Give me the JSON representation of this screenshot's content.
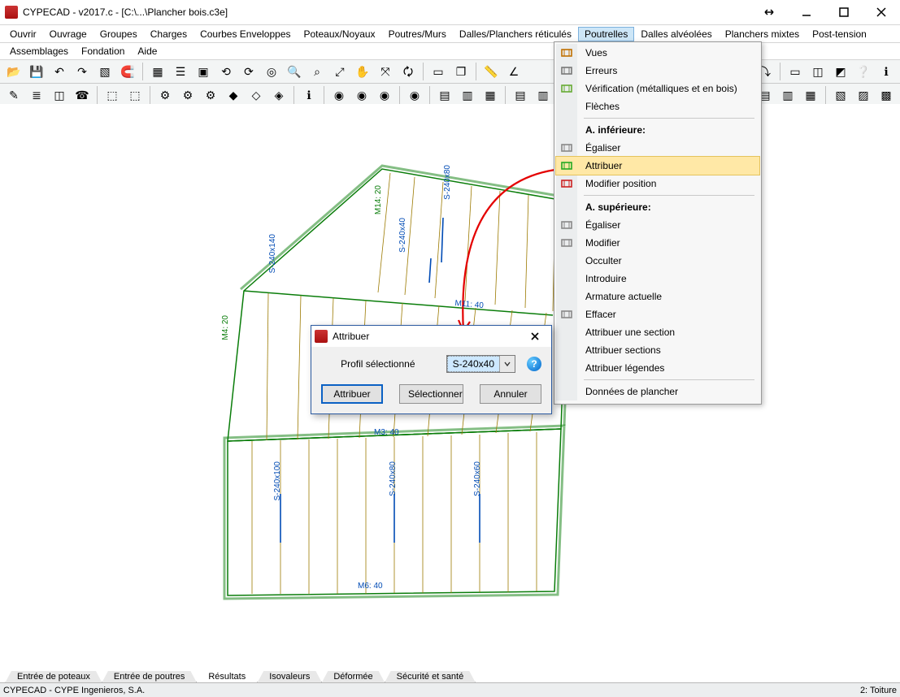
{
  "window": {
    "title": "CYPECAD - v2017.c - [C:\\...\\Plancher bois.c3e]"
  },
  "menubar": {
    "row1": [
      "Ouvrir",
      "Ouvrage",
      "Groupes",
      "Charges",
      "Courbes Enveloppes",
      "Poteaux/Noyaux",
      "Poutres/Murs",
      "Dalles/Planchers réticulés",
      "Poutrelles",
      "Dalles alvéolées",
      "Planchers mixtes",
      "Post-tension"
    ],
    "row2": [
      "Assemblages",
      "Fondation",
      "Aide"
    ],
    "active": 8
  },
  "dropdown": {
    "items": [
      {
        "type": "item",
        "label": "Vues",
        "icon": "beam-top"
      },
      {
        "type": "item",
        "label": "Erreurs",
        "icon": "beam-error"
      },
      {
        "type": "item",
        "label": "Vérification (métalliques et en bois)",
        "icon": "beam-check"
      },
      {
        "type": "item",
        "label": "Flèches"
      },
      {
        "type": "sep"
      },
      {
        "type": "header",
        "label": "A. inférieure:"
      },
      {
        "type": "item",
        "label": "Égaliser",
        "icon": "eq-bottom"
      },
      {
        "type": "item",
        "label": "Attribuer",
        "icon": "attr-bottom",
        "hi": true
      },
      {
        "type": "item",
        "label": "Modifier position",
        "icon": "pos-bottom"
      },
      {
        "type": "sep"
      },
      {
        "type": "header",
        "label": "A. supérieure:"
      },
      {
        "type": "item",
        "label": "Égaliser",
        "icon": "eq-top"
      },
      {
        "type": "item",
        "label": "Modifier",
        "icon": "mod-top"
      },
      {
        "type": "item",
        "label": "Occulter"
      },
      {
        "type": "item",
        "label": "Introduire"
      },
      {
        "type": "item",
        "label": "Armature actuelle"
      },
      {
        "type": "item",
        "label": "Effacer",
        "icon": "erase"
      },
      {
        "type": "item",
        "label": "Attribuer une section"
      },
      {
        "type": "item",
        "label": "Attribuer sections"
      },
      {
        "type": "item",
        "label": "Attribuer légendes"
      },
      {
        "type": "sep"
      },
      {
        "type": "item",
        "label": "Données de plancher"
      }
    ]
  },
  "dialog": {
    "title": "Attribuer",
    "field_label": "Profil sélectionné",
    "field_value": "S-240x40",
    "buttons": {
      "ok": "Attribuer",
      "select": "Sélectionner",
      "cancel": "Annuler"
    }
  },
  "drawing": {
    "beams": [
      "S-240x100",
      "S-240x80",
      "S-240x60",
      "S-240x140",
      "S-240x40",
      "S-240x80"
    ],
    "girders": [
      "M3: 40",
      "M4: 20",
      "M6: 40",
      "M11: 40",
      "M14: 20"
    ]
  },
  "tabs": [
    "Entrée de poteaux",
    "Entrée de poutres",
    "Résultats",
    "Isovaleurs",
    "Déformée",
    "Sécurité et santé"
  ],
  "tabs_active": 2,
  "status": {
    "left1": "CYPECAD - CYPE Ingenieros, S.A.",
    "left2": "",
    "right": "2: Toiture"
  },
  "toolbar_icons_row1": [
    "open",
    "save",
    "undo",
    "redo",
    "hatch",
    "magnet",
    "",
    "grid",
    "layers",
    "color",
    "rotl",
    "rotr",
    "target",
    "find",
    "zoom-win",
    "zoom-out",
    "pan",
    "zoom-all",
    "refresh",
    "",
    "page",
    "pages",
    "",
    "ruler",
    "angle"
  ],
  "toolbar_icons_row2": [
    "edit",
    "stairs",
    "bh",
    "phone",
    "",
    "cube",
    "cubes",
    "",
    "bolt",
    "boltx",
    "bolt2",
    "b1",
    "b2",
    "b3",
    "",
    "info",
    "",
    "cirA",
    "cirB",
    "cirC",
    "",
    "cirD",
    "",
    "a1",
    "a2",
    "a3",
    "",
    "h1",
    "h2",
    "h3",
    "h4",
    "",
    "g1",
    "g2",
    "g3",
    "g4",
    "g5"
  ],
  "toolbar_icons_right_row1": [
    "t1",
    "",
    "t2",
    "t3",
    "",
    "t4",
    "t5",
    "t6",
    "help",
    "about"
  ],
  "toolbar_icons_right_row2": [
    "r1",
    "r2",
    "r3",
    "",
    "r4",
    "r5",
    "r6"
  ]
}
